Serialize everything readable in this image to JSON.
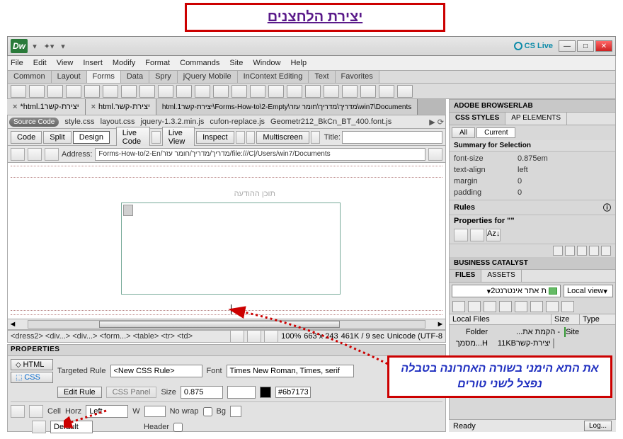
{
  "overlay": {
    "top_title": "יצירת הלחצנים",
    "bottom_text": "את התא הימני בשורה האחרונה בטבלה נפצל לשני טורים"
  },
  "appbar": {
    "logo": "Dw",
    "cslive": "CS Live"
  },
  "menubar": [
    "File",
    "Edit",
    "View",
    "Insert",
    "Modify",
    "Format",
    "Commands",
    "Site",
    "Window",
    "Help"
  ],
  "insert_tabs": [
    "Common",
    "Layout",
    "Forms",
    "Data",
    "Spry",
    "jQuery Mobile",
    "InContext Editing",
    "Text",
    "Favorites"
  ],
  "insert_active": "Forms",
  "doc_tabs": [
    "יצירת-קשר1.html*",
    "יצירת-קשר.html",
    "win7\\Documents\\מדריך\\מדריך\\חומר עזר\\Forms-How-to\\2-Empty\\יצירת-קשר1.html"
  ],
  "related": {
    "source_btn": "Source Code",
    "files": [
      "style.css",
      "layout.css",
      "jquery-1.3.2.min.js",
      "cufon-replace.js",
      "Geometr212_BkCn_BT_400.font.js"
    ]
  },
  "viewbar": {
    "code": "Code",
    "split": "Split",
    "design": "Design",
    "livecode": "Live Code",
    "liveview": "Live View",
    "inspect": "Inspect",
    "multiscreen": "Multiscreen",
    "title_label": "Title:"
  },
  "addressbar": {
    "label": "Address:",
    "value": "file:///C|/Users/win7/Documents/מדריך/מדריך/חומר עזר/Forms-How-to/2-En"
  },
  "canvas": {
    "message_label": "תוכן ההודעה"
  },
  "status": {
    "tagpath": "<dress2> <div...> <div...> <form...> <table> <tr> <td>",
    "zoom": "100%",
    "dims": "663 x 243",
    "size_time": "461K / 9 sec",
    "encoding": "Unicode (UTF-8"
  },
  "properties": {
    "header": "PROPERTIES",
    "html_btn": "HTML",
    "css_btn": "CSS",
    "targeted_rule_label": "Targeted Rule",
    "targeted_rule_value": "<New CSS Rule>",
    "edit_rule": "Edit Rule",
    "css_panel": "CSS Panel",
    "font_label": "Font",
    "font_value": "Times New Roman, Times, serif",
    "size_label": "Size",
    "size_value": "0.875",
    "color_value": "#6b7173",
    "cell_label": "Cell",
    "horz_label": "Horz",
    "horz_value": "Left",
    "w_label": "W",
    "nowrap_label": "No wrap",
    "bg_label": "Bg",
    "vert_value": "Default",
    "header_label": "Header"
  },
  "right": {
    "browserlab": "ADOBE BROWSERLAB",
    "css_tab": "CSS STYLES",
    "ap_tab": "AP ELEMENTS",
    "all_btn": "All",
    "current_btn": "Current",
    "summary_label": "Summary for Selection",
    "summary": [
      {
        "k": "font-size",
        "v": "0.875em"
      },
      {
        "k": "text-align",
        "v": "left"
      },
      {
        "k": "margin",
        "v": "0"
      },
      {
        "k": "padding",
        "v": "0"
      }
    ],
    "rules_label": "Rules",
    "props_label": "Properties for \"\"",
    "bizcat": "BUSINESS CATALYST",
    "files_tab": "FILES",
    "assets_tab": "ASSETS",
    "site_sel": "ת אתר אינטרנט2",
    "view_sel": "Local view",
    "filehdr": [
      "Local Files",
      "Size",
      "Type"
    ],
    "tree_root": "Site - הקמת את...",
    "tree_root_type": "Folder",
    "tree_file": "יצירת-קשר",
    "tree_size": "11KB",
    "tree_file_type": "H...מסמך",
    "ready": "Ready",
    "log_btn": "Log..."
  }
}
